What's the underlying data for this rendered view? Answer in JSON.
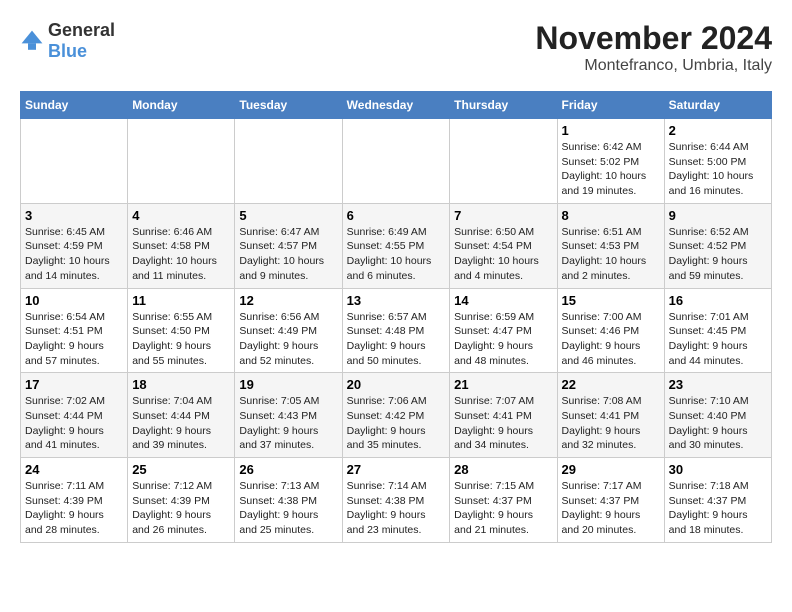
{
  "logo": {
    "general": "General",
    "blue": "Blue"
  },
  "header": {
    "month": "November 2024",
    "location": "Montefranco, Umbria, Italy"
  },
  "days_of_week": [
    "Sunday",
    "Monday",
    "Tuesday",
    "Wednesday",
    "Thursday",
    "Friday",
    "Saturday"
  ],
  "weeks": [
    [
      {
        "day": "",
        "info": ""
      },
      {
        "day": "",
        "info": ""
      },
      {
        "day": "",
        "info": ""
      },
      {
        "day": "",
        "info": ""
      },
      {
        "day": "",
        "info": ""
      },
      {
        "day": "1",
        "info": "Sunrise: 6:42 AM\nSunset: 5:02 PM\nDaylight: 10 hours and 19 minutes."
      },
      {
        "day": "2",
        "info": "Sunrise: 6:44 AM\nSunset: 5:00 PM\nDaylight: 10 hours and 16 minutes."
      }
    ],
    [
      {
        "day": "3",
        "info": "Sunrise: 6:45 AM\nSunset: 4:59 PM\nDaylight: 10 hours and 14 minutes."
      },
      {
        "day": "4",
        "info": "Sunrise: 6:46 AM\nSunset: 4:58 PM\nDaylight: 10 hours and 11 minutes."
      },
      {
        "day": "5",
        "info": "Sunrise: 6:47 AM\nSunset: 4:57 PM\nDaylight: 10 hours and 9 minutes."
      },
      {
        "day": "6",
        "info": "Sunrise: 6:49 AM\nSunset: 4:55 PM\nDaylight: 10 hours and 6 minutes."
      },
      {
        "day": "7",
        "info": "Sunrise: 6:50 AM\nSunset: 4:54 PM\nDaylight: 10 hours and 4 minutes."
      },
      {
        "day": "8",
        "info": "Sunrise: 6:51 AM\nSunset: 4:53 PM\nDaylight: 10 hours and 2 minutes."
      },
      {
        "day": "9",
        "info": "Sunrise: 6:52 AM\nSunset: 4:52 PM\nDaylight: 9 hours and 59 minutes."
      }
    ],
    [
      {
        "day": "10",
        "info": "Sunrise: 6:54 AM\nSunset: 4:51 PM\nDaylight: 9 hours and 57 minutes."
      },
      {
        "day": "11",
        "info": "Sunrise: 6:55 AM\nSunset: 4:50 PM\nDaylight: 9 hours and 55 minutes."
      },
      {
        "day": "12",
        "info": "Sunrise: 6:56 AM\nSunset: 4:49 PM\nDaylight: 9 hours and 52 minutes."
      },
      {
        "day": "13",
        "info": "Sunrise: 6:57 AM\nSunset: 4:48 PM\nDaylight: 9 hours and 50 minutes."
      },
      {
        "day": "14",
        "info": "Sunrise: 6:59 AM\nSunset: 4:47 PM\nDaylight: 9 hours and 48 minutes."
      },
      {
        "day": "15",
        "info": "Sunrise: 7:00 AM\nSunset: 4:46 PM\nDaylight: 9 hours and 46 minutes."
      },
      {
        "day": "16",
        "info": "Sunrise: 7:01 AM\nSunset: 4:45 PM\nDaylight: 9 hours and 44 minutes."
      }
    ],
    [
      {
        "day": "17",
        "info": "Sunrise: 7:02 AM\nSunset: 4:44 PM\nDaylight: 9 hours and 41 minutes."
      },
      {
        "day": "18",
        "info": "Sunrise: 7:04 AM\nSunset: 4:44 PM\nDaylight: 9 hours and 39 minutes."
      },
      {
        "day": "19",
        "info": "Sunrise: 7:05 AM\nSunset: 4:43 PM\nDaylight: 9 hours and 37 minutes."
      },
      {
        "day": "20",
        "info": "Sunrise: 7:06 AM\nSunset: 4:42 PM\nDaylight: 9 hours and 35 minutes."
      },
      {
        "day": "21",
        "info": "Sunrise: 7:07 AM\nSunset: 4:41 PM\nDaylight: 9 hours and 34 minutes."
      },
      {
        "day": "22",
        "info": "Sunrise: 7:08 AM\nSunset: 4:41 PM\nDaylight: 9 hours and 32 minutes."
      },
      {
        "day": "23",
        "info": "Sunrise: 7:10 AM\nSunset: 4:40 PM\nDaylight: 9 hours and 30 minutes."
      }
    ],
    [
      {
        "day": "24",
        "info": "Sunrise: 7:11 AM\nSunset: 4:39 PM\nDaylight: 9 hours and 28 minutes."
      },
      {
        "day": "25",
        "info": "Sunrise: 7:12 AM\nSunset: 4:39 PM\nDaylight: 9 hours and 26 minutes."
      },
      {
        "day": "26",
        "info": "Sunrise: 7:13 AM\nSunset: 4:38 PM\nDaylight: 9 hours and 25 minutes."
      },
      {
        "day": "27",
        "info": "Sunrise: 7:14 AM\nSunset: 4:38 PM\nDaylight: 9 hours and 23 minutes."
      },
      {
        "day": "28",
        "info": "Sunrise: 7:15 AM\nSunset: 4:37 PM\nDaylight: 9 hours and 21 minutes."
      },
      {
        "day": "29",
        "info": "Sunrise: 7:17 AM\nSunset: 4:37 PM\nDaylight: 9 hours and 20 minutes."
      },
      {
        "day": "30",
        "info": "Sunrise: 7:18 AM\nSunset: 4:37 PM\nDaylight: 9 hours and 18 minutes."
      }
    ]
  ]
}
